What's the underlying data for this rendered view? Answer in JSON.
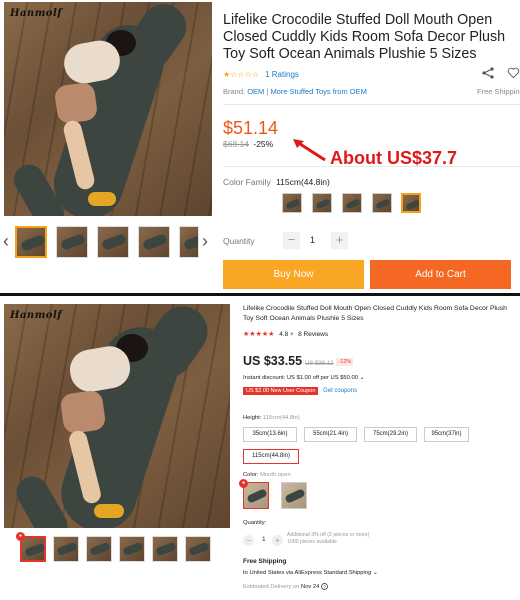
{
  "top": {
    "brand_mark": "Hanmolf",
    "title": "Lifelike Crocodile Stuffed Doll Mouth Open Closed Cuddly Kids Room Sofa Decor Plush Toy Soft Ocean Animals Plushie 5 Sizes",
    "rating_stars": "★☆☆☆☆",
    "ratings_count": "1 Ratings",
    "brand_label": "Brand:",
    "brand_name": "OEM",
    "brand_sep": "|",
    "more_link": "More Stuffed Toys from OEM",
    "free_shipping": "Free Shipping",
    "price": "$51.14",
    "old_price": "$68.14",
    "discount_pct": "-25%",
    "annotation": "About US$37.7",
    "color_family_label": "Color Family",
    "color_family_value": "115cm(44.8in)",
    "quantity_label": "Quantity",
    "quantity_value": "1",
    "minus": "−",
    "plus": "+",
    "buy_now": "Buy Now",
    "add_to_cart": "Add to Cart",
    "prev_arrow": "‹",
    "next_arrow": "›"
  },
  "bottom": {
    "brand_mark": "Hanmolf",
    "title": "Lifelike Crocodile Stuffed Doll Mouth Open Closed Cuddly Kids Room Sofa Decor Plush Toy Soft Ocean Animals Plushie 5 Sizes",
    "stars": "★★★★★",
    "rating_value": "4.8",
    "caret": "▾",
    "reviews": "8 Reviews",
    "price": "US $33.55",
    "old_price": "US $38.12",
    "discount_pct": "-12%",
    "instant_discount": "Instant discount: US $1.00 off per US $50.00 ⌄",
    "coupon": "US $2.00 New User Coupon",
    "get_coupons": "Get coupons",
    "height_label": "Height:",
    "height_value": "115cm(44.8in)",
    "sizes": [
      "35cm(13.6in)",
      "55cm(21.4in)",
      "75cm(29.2in)",
      "95cm(37in)",
      "115cm(44.8in)"
    ],
    "color_label": "Color:",
    "color_value": "Mouth open",
    "quantity_label": "Quantity:",
    "quantity_value": "1",
    "minus": "−",
    "plus": "+",
    "qty_note_1": "Additional 3% off (2 pieces or more)",
    "qty_note_2": "1000 pieces available",
    "shipping_title": "Free Shipping",
    "shipping_sub": "to United States via AliExpress Standard Shipping ⌄",
    "delivery_label": "Estimated Delivery on",
    "delivery_date": "Nov 24"
  },
  "colors": {
    "lazada_orange": "#f56823",
    "lazada_yellow": "#f8a623",
    "price_orange": "#f4541a",
    "ali_red": "#e3352b",
    "link_blue": "#1a7cc9"
  }
}
